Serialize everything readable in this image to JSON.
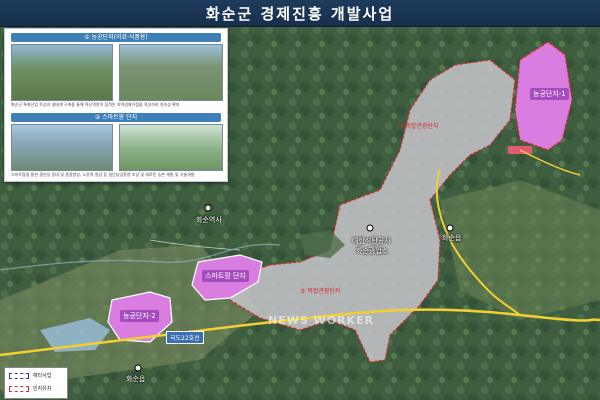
{
  "title": "화순군 경제진흥 개발사업",
  "inset": {
    "section1_heading": "① 농공단지(의료·식품용)",
    "section1_text": "화순군 특화산업 육성과 생태계 구축을 통해 혁신역량이 집적된 지역경제거점을 육성하여 지속성 확보",
    "section2_heading": "② 스마트팜 단지",
    "section2_text": "스마트팜을 통한 생산성 증대 및 품질향상, 노동력 절감 등 첨단농업환경 조성 및 새로운 농촌 개발 및 기술개발"
  },
  "zones": {
    "complex_north": "③ 복합관광단지",
    "complex_south": "③ 복합관광단지",
    "smart_farm": "스마트팜 단지",
    "agri_complex_1": "농공단지-1",
    "agri_complex_2": "농공단지-2"
  },
  "places": {
    "place_west": "화순역사",
    "place_center": "대한석탄공사",
    "place_center_sub": "화순광업소",
    "place_east": "화순읍",
    "place_south": "화순읍"
  },
  "route": "국도22호선",
  "legend": {
    "item1": "예타사업",
    "item2": "민자유치"
  },
  "watermark": "NEWS WORKER",
  "colors": {
    "title_bar": "#1e3b5c",
    "complex_fill": "#c8c6cc",
    "agri_fill": "#d97ee0",
    "boundary": "#e0272b",
    "road": "#f2d033",
    "legend_blue": "#1f3c9a"
  }
}
